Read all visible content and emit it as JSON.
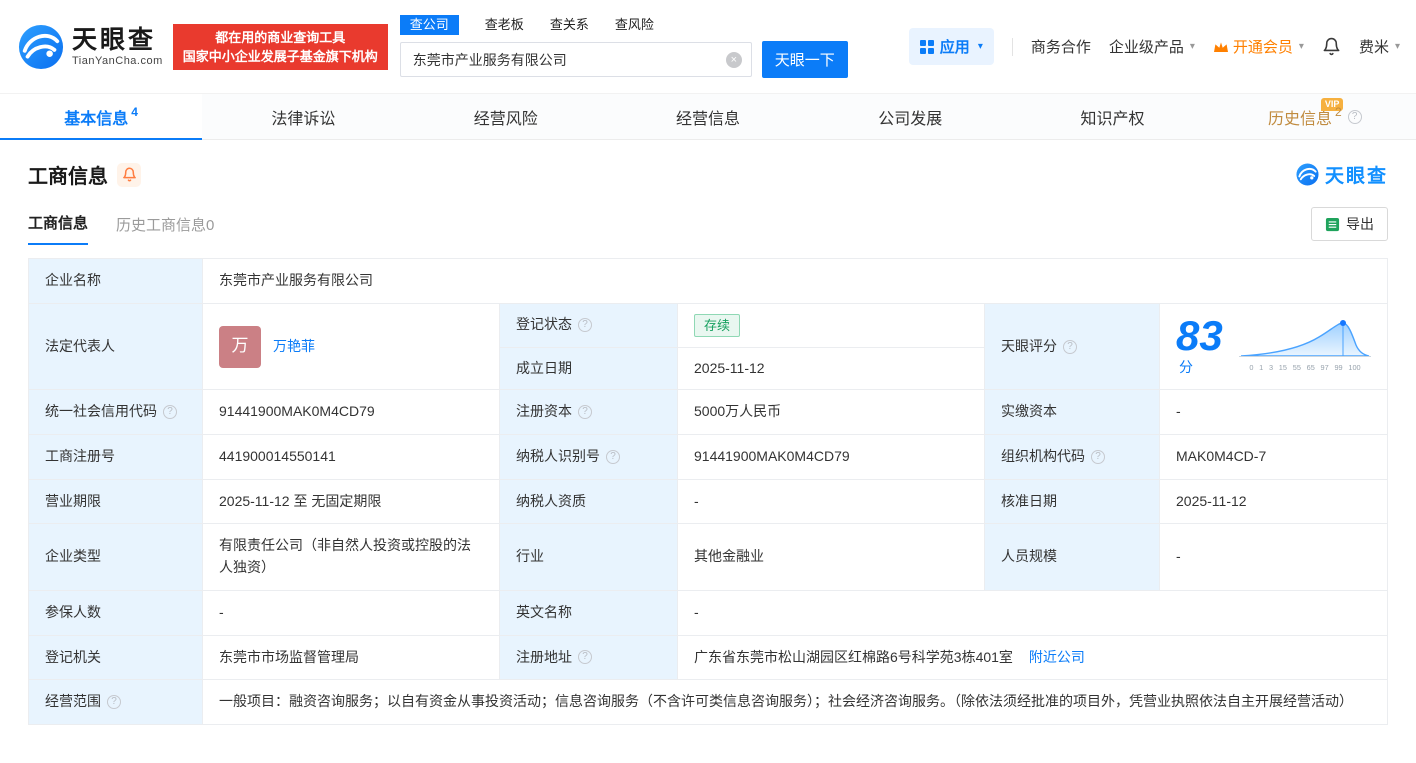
{
  "brand": {
    "name": "天眼查",
    "domain": "TianYanCha.com",
    "slogan_line1": "都在用的商业查询工具",
    "slogan_line2": "国家中小企业发展子基金旗下机构"
  },
  "search": {
    "tabs": [
      {
        "label": "查公司"
      },
      {
        "label": "查老板"
      },
      {
        "label": "查关系"
      },
      {
        "label": "查风险"
      }
    ],
    "value": "东莞市产业服务有限公司",
    "button_label": "天眼一下"
  },
  "header_menu": {
    "apps_label": "应用",
    "cooperation_label": "商务合作",
    "enterprise_label": "企业级产品",
    "vip_label": "开通会员",
    "user_label": "费米"
  },
  "nav": {
    "tabs": [
      {
        "label": "基本信息",
        "badge": "4"
      },
      {
        "label": "法律诉讼",
        "badge": ""
      },
      {
        "label": "经营风险",
        "badge": ""
      },
      {
        "label": "经营信息",
        "badge": ""
      },
      {
        "label": "公司发展",
        "badge": ""
      },
      {
        "label": "知识产权",
        "badge": ""
      },
      {
        "label": "历史信息",
        "badge": "2"
      }
    ],
    "vip_tag": "VIP"
  },
  "section": {
    "title": "工商信息",
    "watermark": "天眼查",
    "subtab_active": "工商信息",
    "subtab_inactive": "历史工商信息0",
    "export_label": "导出"
  },
  "table": {
    "company_name": {
      "label": "企业名称",
      "value": "东莞市产业服务有限公司"
    },
    "legal_rep": {
      "label": "法定代表人",
      "avatar": "万",
      "value": "万艳菲"
    },
    "reg_status": {
      "label": "登记状态",
      "value": "存续"
    },
    "establish_date": {
      "label": "成立日期",
      "value": "2025-11-12"
    },
    "score": {
      "label": "天眼评分",
      "value": "83",
      "unit": "分",
      "ticks": "0 1 3 15 55 65 97 99 100"
    },
    "credit_code": {
      "label": "统一社会信用代码",
      "value": "91441900MAK0M4CD79"
    },
    "reg_capital": {
      "label": "注册资本",
      "value": "5000万人民币"
    },
    "paid_capital": {
      "label": "实缴资本",
      "value": "-"
    },
    "reg_number": {
      "label": "工商注册号",
      "value": "441900014550141"
    },
    "taxpayer_id": {
      "label": "纳税人识别号",
      "value": "91441900MAK0M4CD79"
    },
    "org_code": {
      "label": "组织机构代码",
      "value": "MAK0M4CD-7"
    },
    "business_term": {
      "label": "营业期限",
      "value": "2025-11-12 至 无固定期限"
    },
    "taxpayer_quality": {
      "label": "纳税人资质",
      "value": "-"
    },
    "approval_date": {
      "label": "核准日期",
      "value": "2025-11-12"
    },
    "company_type": {
      "label": "企业类型",
      "value": "有限责任公司（非自然人投资或控股的法人独资）"
    },
    "industry": {
      "label": "行业",
      "value": "其他金融业"
    },
    "staff_size": {
      "label": "人员规模",
      "value": "-"
    },
    "insured_count": {
      "label": "参保人数",
      "value": "-"
    },
    "english_name": {
      "label": "英文名称",
      "value": "-"
    },
    "reg_authority": {
      "label": "登记机关",
      "value": "东莞市市场监督管理局"
    },
    "reg_address": {
      "label": "注册地址",
      "value": "广东省东莞市松山湖园区红棉路6号科学苑3栋401室",
      "link": "附近公司"
    },
    "business_scope": {
      "label": "经营范围",
      "value": "一般项目：融资咨询服务；以自有资金从事投资活动；信息咨询服务（不含许可类信息咨询服务）；社会经济咨询服务。（除依法须经批准的项目外，凭营业执照依法自主开展经营活动）"
    }
  },
  "icons": {
    "help": "?",
    "clear": "×",
    "caret": "▾"
  }
}
